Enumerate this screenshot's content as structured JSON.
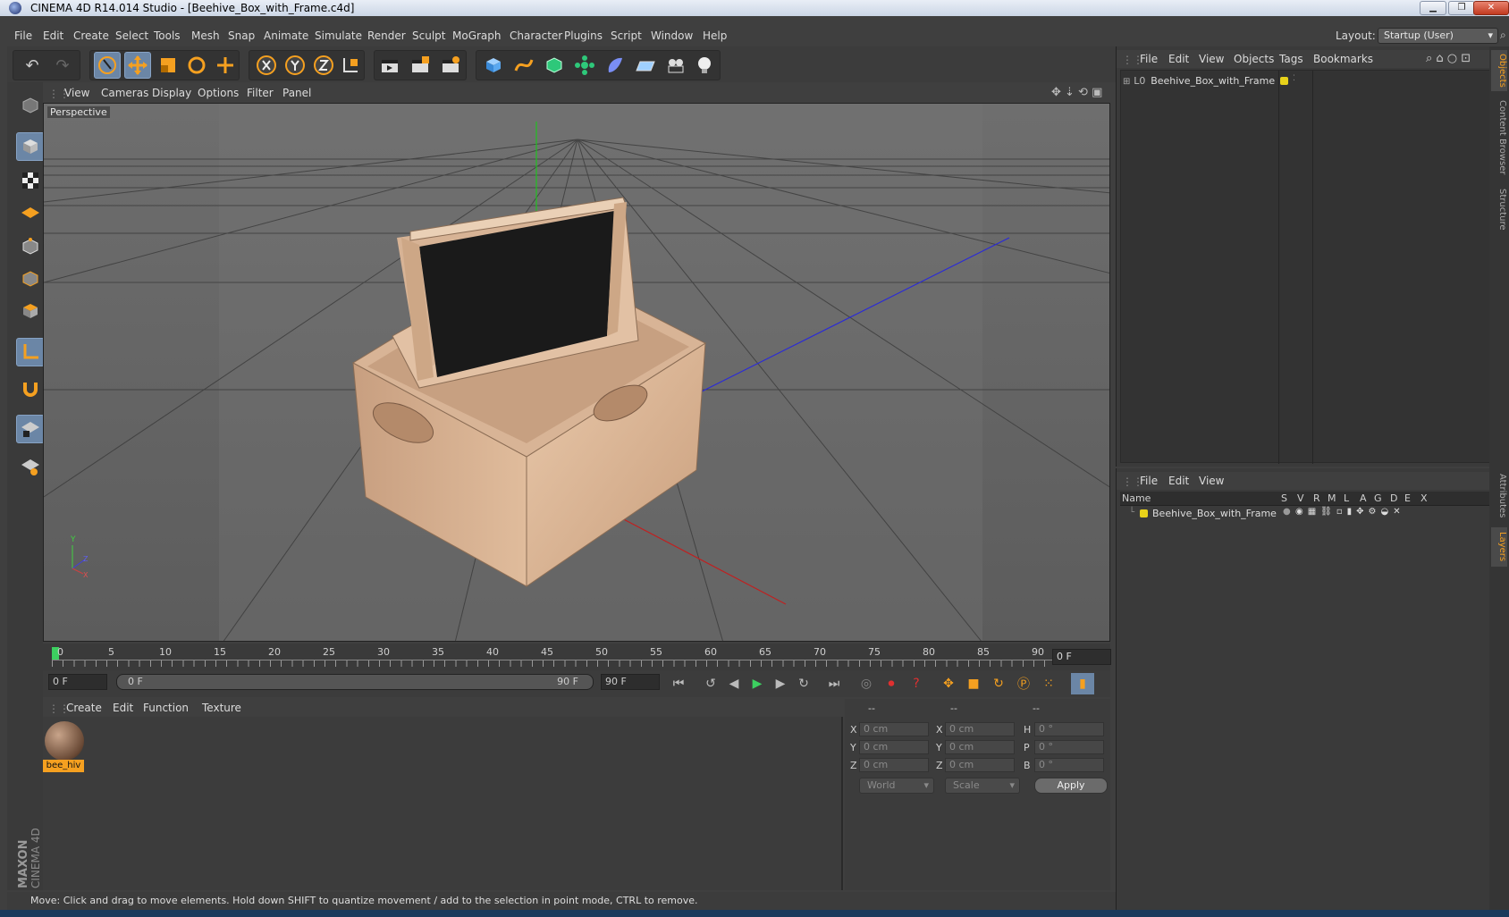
{
  "window": {
    "title": "CINEMA 4D R14.014 Studio - [Beehive_Box_with_Frame.c4d]",
    "min": "▁",
    "max": "❐",
    "close": "✕"
  },
  "menu": {
    "items": [
      "File",
      "Edit",
      "Create",
      "Select",
      "Tools",
      "Mesh",
      "Snap",
      "Animate",
      "Simulate",
      "Render",
      "Sculpt",
      "MoGraph",
      "Character",
      "Plugins",
      "Script",
      "Window",
      "Help"
    ],
    "layout_label": "Layout:",
    "layout_value": "Startup (User)"
  },
  "viewport": {
    "menu": [
      "View",
      "Cameras",
      "Display",
      "Options",
      "Filter",
      "Panel"
    ],
    "label": "Perspective",
    "axis_y": "Y",
    "axis_z": "Z",
    "axis_x": "X"
  },
  "timeline": {
    "ticks": [
      "0",
      "5",
      "10",
      "15",
      "20",
      "25",
      "30",
      "35",
      "40",
      "45",
      "50",
      "55",
      "60",
      "65",
      "70",
      "75",
      "80",
      "85",
      "90"
    ],
    "frame_indicator": "0 F",
    "current_frame": "0 F",
    "range_start": "0 F",
    "range_end": "90 F",
    "end_frame": "90 F"
  },
  "material": {
    "menu": [
      "Create",
      "Edit",
      "Function",
      "Texture"
    ],
    "name": "bee_hiv"
  },
  "coords": {
    "headers": [
      "--",
      "--",
      "--"
    ],
    "rows": [
      {
        "a": "X",
        "av": "0 cm",
        "b": "X",
        "bv": "0 cm",
        "c": "H",
        "cv": "0 °"
      },
      {
        "a": "Y",
        "av": "0 cm",
        "b": "Y",
        "bv": "0 cm",
        "c": "P",
        "cv": "0 °"
      },
      {
        "a": "Z",
        "av": "0 cm",
        "b": "Z",
        "bv": "0 cm",
        "c": "B",
        "cv": "0 °"
      }
    ],
    "world": "World",
    "scale": "Scale",
    "apply": "Apply"
  },
  "status": "Move: Click and drag to move elements. Hold down SHIFT to quantize movement / add to the selection in point mode, CTRL to remove.",
  "objects": {
    "menu": [
      "File",
      "Edit",
      "View",
      "Objects",
      "Tags",
      "Bookmarks"
    ],
    "item": "Beehive_Box_with_Frame"
  },
  "layers": {
    "menu": [
      "File",
      "Edit",
      "View"
    ],
    "columns": [
      "Name",
      "S",
      "V",
      "R",
      "M",
      "L",
      "A",
      "G",
      "D",
      "E",
      "X"
    ],
    "item": "Beehive_Box_with_Frame"
  },
  "sidetabs": [
    "Objects",
    "Content Browser",
    "Structure",
    "Attributes",
    "Layers"
  ],
  "brand": {
    "line1": "MAXON",
    "line2": "CINEMA 4D"
  },
  "colors": {
    "accent": "#f5a020",
    "layer_dot": "#e8d21a",
    "selected_btn": "#6b86a6"
  }
}
